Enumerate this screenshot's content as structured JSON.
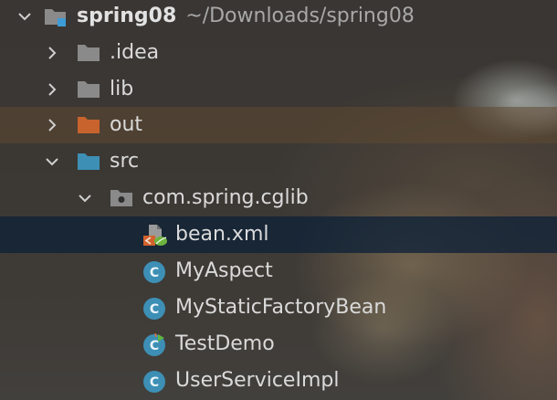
{
  "project": {
    "name": "spring08",
    "path": "~/Downloads/spring08"
  },
  "items": [
    {
      "label": ".idea",
      "kind": "folder",
      "color": "#8a8a8a"
    },
    {
      "label": "lib",
      "kind": "folder",
      "color": "#8a8a8a"
    },
    {
      "label": "out",
      "kind": "folder",
      "color": "#c8632d"
    },
    {
      "label": "src",
      "kind": "folder",
      "color": "#3d8fb5"
    },
    {
      "label": "com.spring.cglib",
      "kind": "package"
    },
    {
      "label": "bean.xml",
      "kind": "spring-xml"
    },
    {
      "label": "MyAspect",
      "kind": "class"
    },
    {
      "label": "MyStaticFactoryBean",
      "kind": "class"
    },
    {
      "label": "TestDemo",
      "kind": "class-runnable"
    },
    {
      "label": "UserServiceImpl",
      "kind": "class"
    }
  ],
  "colors": {
    "selected_row": "#0e2137",
    "class_icon": "#3d8fb5",
    "source_folder": "#3d8fb5",
    "excluded_folder": "#c8632d"
  }
}
